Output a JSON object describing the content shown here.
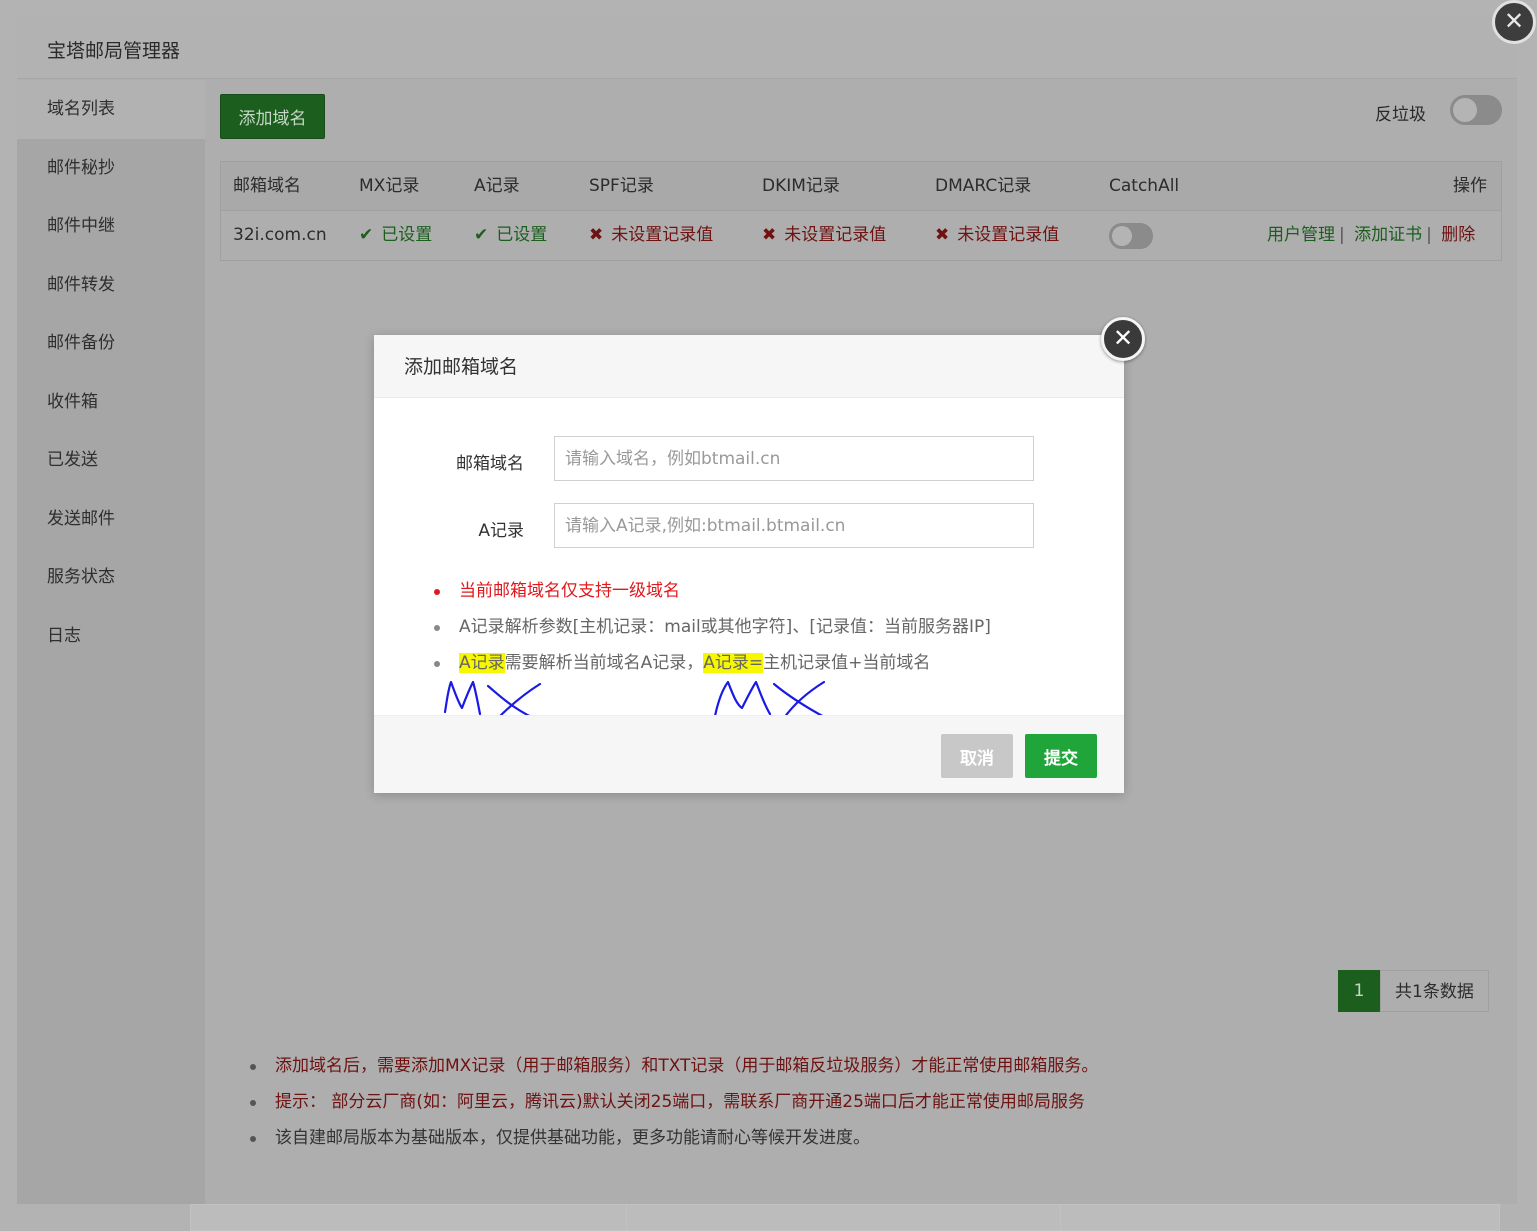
{
  "window": {
    "title": "宝塔邮局管理器",
    "close_glyph": "✕"
  },
  "sidebar": {
    "items": [
      {
        "label": "域名列表"
      },
      {
        "label": "邮件秘抄"
      },
      {
        "label": "邮件中继"
      },
      {
        "label": "邮件转发"
      },
      {
        "label": "邮件备份"
      },
      {
        "label": "收件箱"
      },
      {
        "label": "已发送"
      },
      {
        "label": "发送邮件"
      },
      {
        "label": "服务状态"
      },
      {
        "label": "日志"
      }
    ]
  },
  "toolbar": {
    "add_domain_label": "添加域名",
    "antispam_label": "反垃圾"
  },
  "table": {
    "headers": [
      "邮箱域名",
      "MX记录",
      "A记录",
      "SPF记录",
      "DKIM记录",
      "DMARC记录",
      "CatchAll",
      "操作"
    ],
    "rows": [
      {
        "domain": "32i.com.cn",
        "mx": {
          "mark": "✔",
          "text": "已设置"
        },
        "a": {
          "mark": "✔",
          "text": "已设置"
        },
        "spf": {
          "mark": "✖",
          "text": "未设置记录值"
        },
        "dkim": {
          "mark": "✖",
          "text": "未设置记录值"
        },
        "dmarc": {
          "mark": "✖",
          "text": "未设置记录值"
        },
        "actions": {
          "user_manage": "用户管理",
          "add_cert": "添加证书",
          "delete": "删除",
          "sep": "|"
        }
      }
    ]
  },
  "pager": {
    "current": "1",
    "total_text": "共1条数据"
  },
  "notes": [
    "添加域名后，需要添加MX记录（用于邮箱服务）和TXT记录（用于邮箱反垃圾服务）才能正常使用邮箱服务。",
    "提示： 部分云厂商(如：阿里云，腾讯云)默认关闭25端口，需联系厂商开通25端口后才能正常使用邮局服务",
    "该自建邮局版本为基础版本，仅提供基础功能，更多功能请耐心等候开发进度。"
  ],
  "dialog": {
    "title": "添加邮箱域名",
    "close_glyph": "✕",
    "domain_label": "邮箱域名",
    "domain_placeholder": "请输入域名，例如btmail.cn",
    "domain_value": "",
    "a_label": "A记录",
    "a_placeholder": "请输入A记录,例如:btmail.btmail.cn",
    "a_value": "",
    "tips": {
      "tip1": "当前邮箱域名仅支持一级域名",
      "tip2": "A记录解析参数[主机记录：mail或其他字符]、[记录值：当前服务器IP]",
      "tip3_part1": "A记录",
      "tip3_part2": "需要解析当前域名A记录，",
      "tip3_part3": "A记录=",
      "tip3_part4": "主机记录值+当前域名"
    },
    "cancel_label": "取消",
    "submit_label": "提交"
  },
  "colors": {
    "accent_green": "#20a53a",
    "error_red": "#e0191d",
    "highlight_yellow": "#f7f700",
    "annotation_blue": "#1a1ae6"
  }
}
